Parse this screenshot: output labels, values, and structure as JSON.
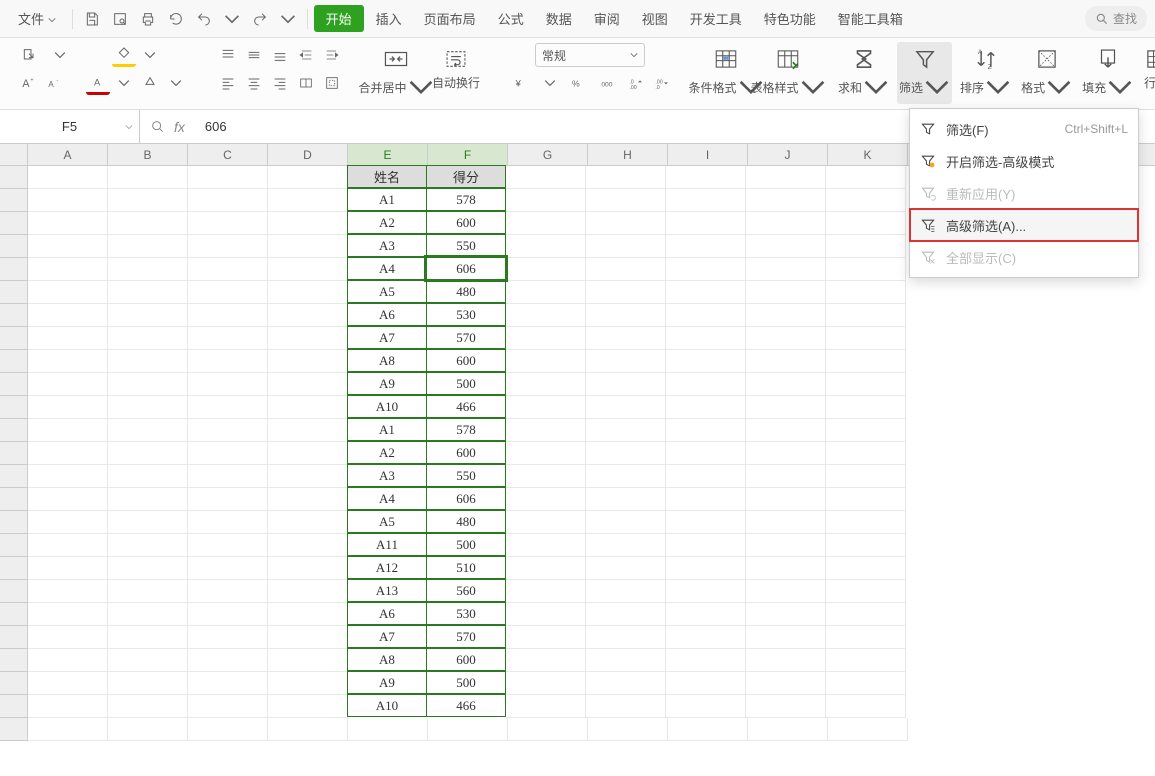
{
  "menubar": {
    "file": "文件",
    "tabs": [
      "开始",
      "插入",
      "页面布局",
      "公式",
      "数据",
      "审阅",
      "视图",
      "开发工具",
      "特色功能",
      "智能工具箱"
    ],
    "active_tab": 0,
    "search": "查找"
  },
  "toolbar": {
    "num_format": "常规",
    "merge": "合并居中",
    "wrap": "自动换行",
    "cond_fmt": "条件格式",
    "table_style": "表格样式",
    "sum": "求和",
    "filter": "筛选",
    "sort": "排序",
    "format": "格式",
    "fill": "填充",
    "rowcol": "行和"
  },
  "formula_bar": {
    "cell_ref": "F5",
    "value": "606"
  },
  "columns": [
    "A",
    "B",
    "C",
    "D",
    "E",
    "F",
    "G",
    "H",
    "I",
    "J",
    "K"
  ],
  "selected_cols": [
    "E",
    "F"
  ],
  "active_cell": {
    "row": 4,
    "col": "F"
  },
  "table": {
    "headers": [
      "姓名",
      "得分"
    ],
    "rows": [
      [
        "A1",
        "578"
      ],
      [
        "A2",
        "600"
      ],
      [
        "A3",
        "550"
      ],
      [
        "A4",
        "606"
      ],
      [
        "A5",
        "480"
      ],
      [
        "A6",
        "530"
      ],
      [
        "A7",
        "570"
      ],
      [
        "A8",
        "600"
      ],
      [
        "A9",
        "500"
      ],
      [
        "A10",
        "466"
      ],
      [
        "A1",
        "578"
      ],
      [
        "A2",
        "600"
      ],
      [
        "A3",
        "550"
      ],
      [
        "A4",
        "606"
      ],
      [
        "A5",
        "480"
      ],
      [
        "A11",
        "500"
      ],
      [
        "A12",
        "510"
      ],
      [
        "A13",
        "560"
      ],
      [
        "A6",
        "530"
      ],
      [
        "A7",
        "570"
      ],
      [
        "A8",
        "600"
      ],
      [
        "A9",
        "500"
      ],
      [
        "A10",
        "466"
      ]
    ]
  },
  "dropdown": {
    "items": [
      {
        "label": "筛选(F)",
        "shortcut": "Ctrl+Shift+L",
        "icon": "filter",
        "disabled": false
      },
      {
        "label": "开启筛选-高级模式",
        "shortcut": "",
        "icon": "filter-plus",
        "disabled": false
      },
      {
        "label": "重新应用(Y)",
        "shortcut": "",
        "icon": "filter-refresh",
        "disabled": true
      },
      {
        "label": "高级筛选(A)...",
        "shortcut": "",
        "icon": "filter-adv",
        "disabled": false,
        "highlight": true
      },
      {
        "label": "全部显示(C)",
        "shortcut": "",
        "icon": "filter-clear",
        "disabled": true
      }
    ]
  }
}
